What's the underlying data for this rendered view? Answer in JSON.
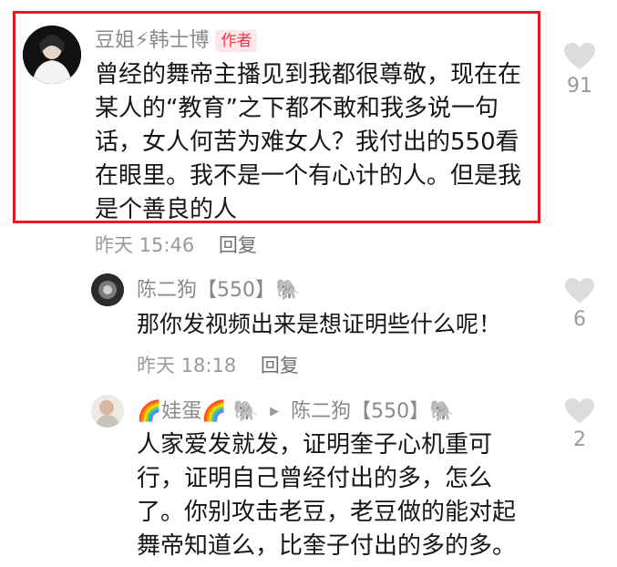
{
  "comments": [
    {
      "author": "豆姐⚡韩士博",
      "badge": "作者",
      "text": "曾经的舞帝主播见到我都很尊敬，现在在某人的“教育”之下都不敢和我多说一句话，女人何苦为难女人？我付出的550看在眼里。我不是一个有心计的人。但是我是个善良的人",
      "lines": [
        "曾经的舞帝主播见到我都很尊敬，现在在",
        "某人的“教育”之下都不敢和我多说一句",
        "话，女人何苦为难女人？我付出的550看",
        "在眼里。我不是一个有心计的人。但是我",
        "是个善良的人"
      ],
      "time": "昨天 15:46",
      "reply_label": "回复",
      "likes": "91"
    },
    {
      "author": "陈二狗【550】🐘",
      "text": "那你发视频出来是想证明些什么呢！",
      "time": "昨天 18:18",
      "reply_label": "回复",
      "likes": "6"
    },
    {
      "author": "🌈娃蛋🌈 🐘",
      "reply_to": "陈二狗【550】🐘",
      "text": "人家爱发就发，证明奎子心机重可行，证明自己曾经付出的多，怎么了。你别攻击老豆，老豆做的能对起舞帝知道么，比奎子付出的多的多。",
      "lines": [
        "人家爱发就发，证明奎子心机重可",
        "行，证明自己曾经付出的多，怎么",
        "了。你别攻击老豆，老豆做的能对起",
        "舞帝知道么，比奎子付出的多的多。"
      ],
      "likes": "2"
    }
  ],
  "colors": {
    "highlight": "#e41b23",
    "badge_bg": "#fde7e8",
    "badge_text": "#e8394a",
    "meta": "#9a9a9a"
  },
  "icons": {
    "like": "heart-icon",
    "reply_arrow": "triangle-right-icon"
  }
}
